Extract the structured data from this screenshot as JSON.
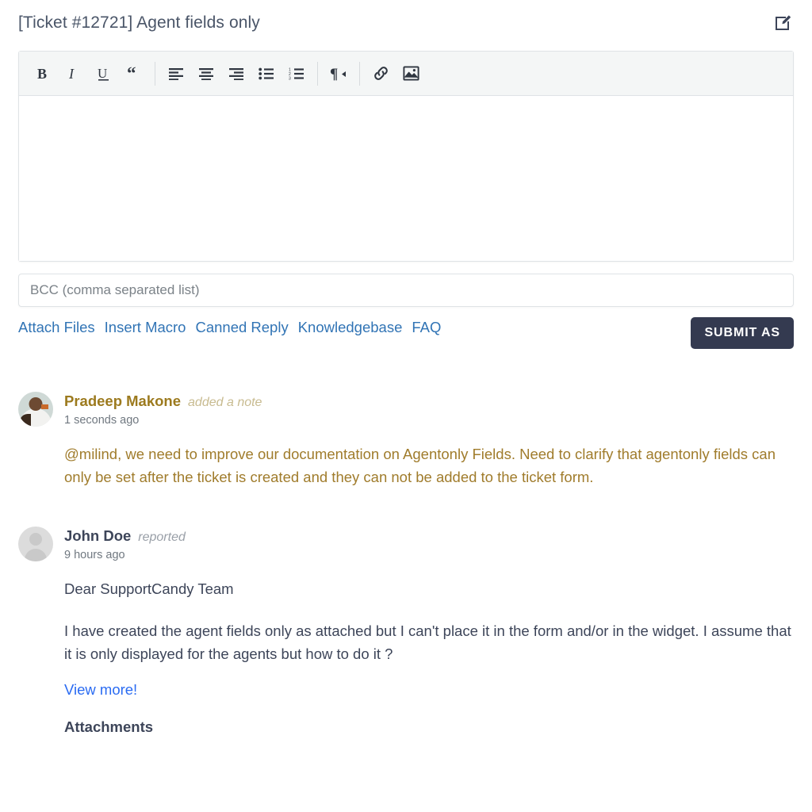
{
  "header": {
    "title": "[Ticket #12721] Agent fields only",
    "edit_icon": "edit-square-pencil-icon"
  },
  "editor": {
    "toolbar": [
      {
        "name": "bold",
        "label": "B",
        "icon": "bold-icon"
      },
      {
        "name": "italic",
        "label": "I",
        "icon": "italic-icon"
      },
      {
        "name": "underline",
        "label": "U",
        "icon": "underline-icon"
      },
      {
        "name": "blockquote",
        "label": "“",
        "icon": "blockquote-icon"
      },
      {
        "name": "align-left",
        "label": "",
        "icon": "align-left-icon"
      },
      {
        "name": "align-center",
        "label": "",
        "icon": "align-center-icon"
      },
      {
        "name": "align-right",
        "label": "",
        "icon": "align-right-icon"
      },
      {
        "name": "unordered-list",
        "label": "",
        "icon": "unordered-list-icon"
      },
      {
        "name": "ordered-list",
        "label": "",
        "icon": "ordered-list-icon"
      },
      {
        "name": "text-direction",
        "label": "¶",
        "icon": "paragraph-rtl-icon"
      },
      {
        "name": "insert-link",
        "label": "",
        "icon": "link-icon"
      },
      {
        "name": "insert-image",
        "label": "",
        "icon": "image-icon"
      }
    ],
    "content": ""
  },
  "bcc": {
    "placeholder": "BCC (comma separated list)",
    "value": ""
  },
  "actions": {
    "links": [
      "Attach Files",
      "Insert Macro",
      "Canned Reply",
      "Knowledgebase",
      "FAQ"
    ],
    "submit_label": "SUBMIT AS"
  },
  "thread": [
    {
      "author": "Pradeep Makone",
      "event": "added a note",
      "timestamp": "1 seconds ago",
      "avatar_type": "photo",
      "kind": "note",
      "paragraphs": [
        "@milind, we need to improve our documentation on Agentonly Fields. Need to clarify that agentonly fields can only be set after the ticket is created and they can not be added to the ticket form."
      ]
    },
    {
      "author": "John Doe",
      "event": "reported",
      "timestamp": "9 hours ago",
      "avatar_type": "default",
      "kind": "reply",
      "paragraphs": [
        "Dear SupportCandy Team",
        "I have created the agent fields only as attached but I can't place it in the form and/or in the widget. I assume that it is only displayed for the agents but how to do it ?"
      ],
      "view_more": "View more!",
      "attachments_label": "Attachments"
    }
  ],
  "colors": {
    "accent_link": "#3174b5",
    "note_text": "#a07c2c",
    "note_author": "#9c7a1e",
    "submit_bg": "#343a50",
    "view_more": "#2a6bf2",
    "body_text": "#3d4559"
  }
}
